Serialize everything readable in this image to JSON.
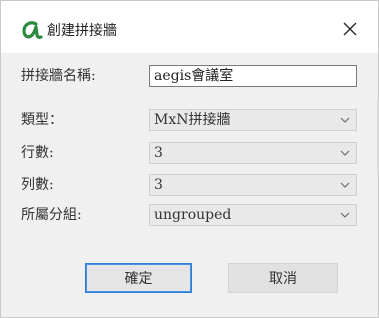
{
  "dialog": {
    "title": "創建拼接牆",
    "close_icon": "close-icon",
    "logo_icon": "alpha-logo-icon",
    "accent_color": "#2a8a3e"
  },
  "form": {
    "name_label": "拼接牆名稱:",
    "name_value": "aegis會議室",
    "type_label": "類型：",
    "type_value": "MxN拼接牆",
    "rows_label": "行數:",
    "rows_value": "3",
    "cols_label": "列數:",
    "cols_value": "3",
    "group_label": "所屬分組:",
    "group_value": "ungrouped"
  },
  "buttons": {
    "ok_label": "確定",
    "cancel_label": "取消"
  }
}
